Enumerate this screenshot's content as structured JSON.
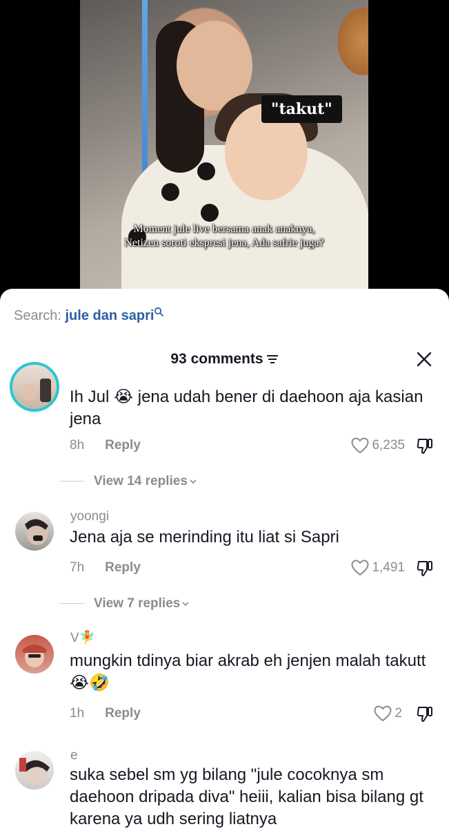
{
  "video": {
    "overlay_label": "\"takut\"",
    "caption_line1": "Moment jule live bersama anak anaknya,",
    "caption_line2": "Netizen soroti ekspresi jena, Ada safrie juga?"
  },
  "search": {
    "prefix": "Search: ",
    "query": "jule dan sapri",
    "icon": "search-icon"
  },
  "comments_header": {
    "title": "93 comments",
    "filter_icon": "filter-icon",
    "close_icon": "close-icon"
  },
  "comments": [
    {
      "username": "",
      "text": "Ih Jul 😭 jena udah bener di daehoon aja kasian jena",
      "time": "8h",
      "reply_label": "Reply",
      "likes": "6,235",
      "view_replies": "View 14 replies"
    },
    {
      "username": "yoongi",
      "text": "Jena aja se merinding itu liat si Sapri",
      "time": "7h",
      "reply_label": "Reply",
      "likes": "1,491",
      "view_replies": "View 7 replies"
    },
    {
      "username": "V🧚",
      "text": "mungkin tdinya biar akrab eh jenjen malah takutt😭🤣",
      "time": "1h",
      "reply_label": "Reply",
      "likes": "2",
      "view_replies": ""
    },
    {
      "username": "e",
      "text": "suka sebel sm yg bilang \"jule cocoknya sm daehoon dripada diva\" heiii, kalian bisa bilang gt karena ya udh sering liatnya",
      "time": "",
      "reply_label": "",
      "likes": "",
      "view_replies": ""
    }
  ],
  "colors": {
    "accent_link": "#2b5fa5",
    "muted_text": "#8a8b91",
    "primary_text": "#161823",
    "avatar_ring": "#27c8d2"
  }
}
